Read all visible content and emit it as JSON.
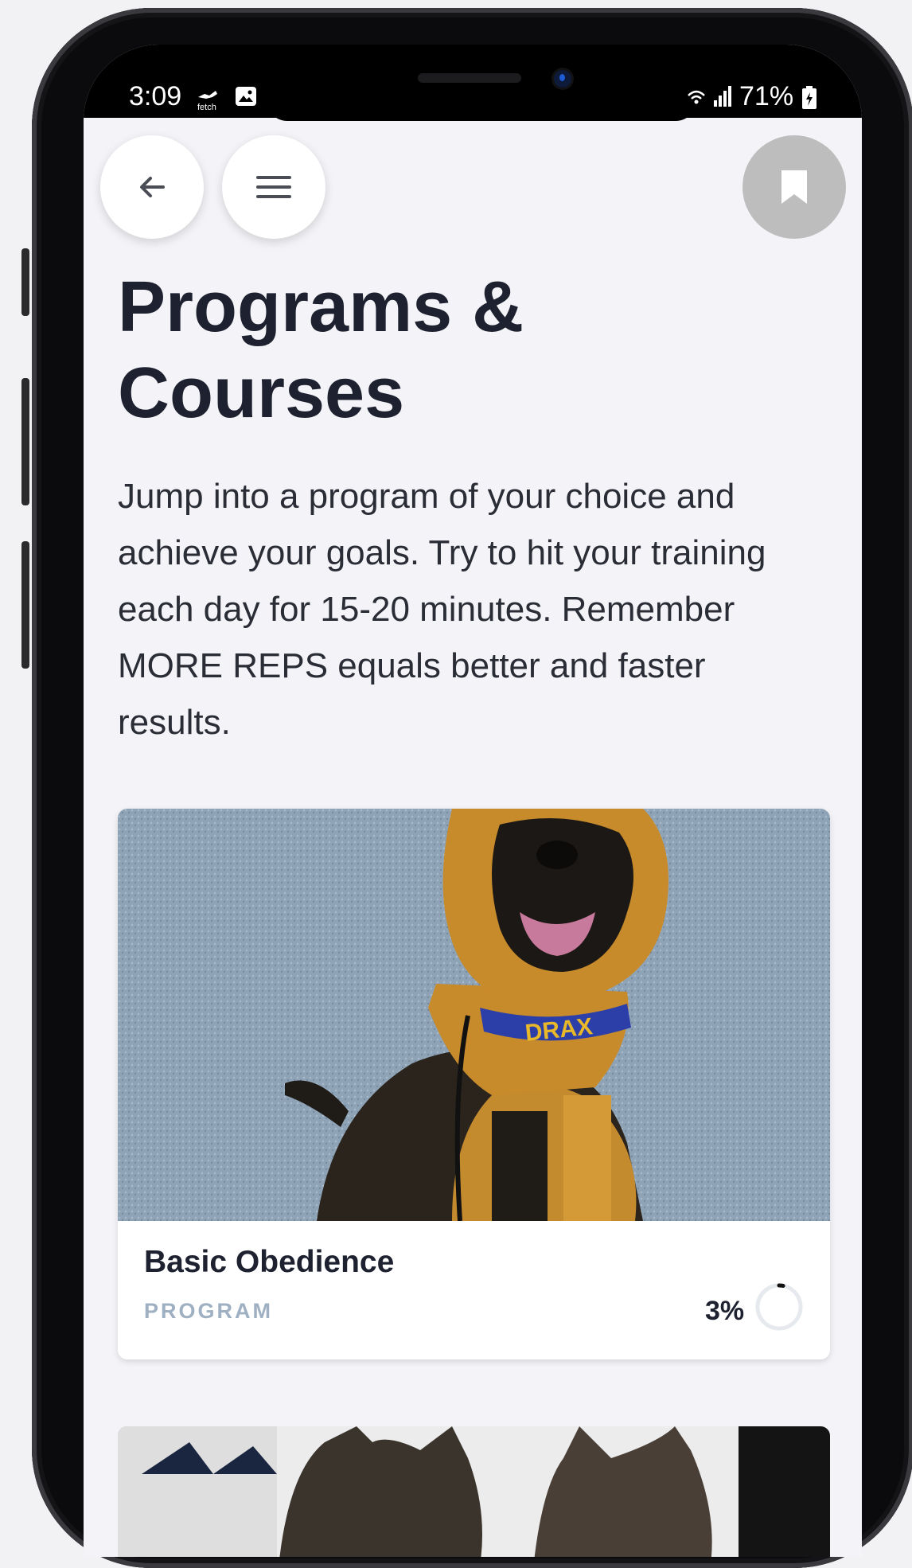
{
  "status_bar": {
    "time": "3:09",
    "notification_icons": [
      "fetch-app-icon",
      "image-icon"
    ],
    "fetch_label": "fetch",
    "battery_percent": "71%",
    "system_icons": [
      "wifi-icon",
      "signal-icon",
      "battery-icon"
    ]
  },
  "toolbar": {
    "back_icon": "arrow-left-icon",
    "menu_icon": "hamburger-menu-icon",
    "bookmark_icon": "bookmark-icon"
  },
  "page": {
    "title": "Programs & Courses",
    "description": "Jump into a program of your choice and achieve your goals. Try to hit your training each day for 15-20 minutes. Remember MORE REPS equals better and faster results."
  },
  "programs": [
    {
      "title": "Basic Obedience",
      "type": "PROGRAM",
      "progress_label": "3%",
      "progress_fraction": 0.03,
      "image_collar_text": "DRAX"
    }
  ],
  "colors": {
    "background": "#f4f4f8",
    "title_text": "#1e2230",
    "type_label": "#9fb0c3",
    "bookmark_button": "#bdbdbd"
  }
}
